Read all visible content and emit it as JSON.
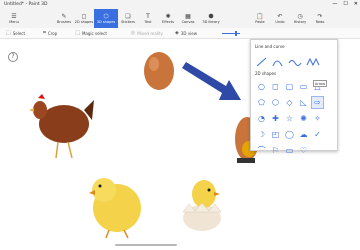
{
  "window": {
    "title": "Untitled* - Paint 3D"
  },
  "ribbon": [
    {
      "label": "Menu",
      "icon": "menu-icon"
    },
    {
      "label": "Brushes",
      "icon": "brush-icon"
    },
    {
      "label": "2D shapes",
      "icon": "shapes2d-icon"
    },
    {
      "label": "3D shapes",
      "icon": "shapes3d-icon"
    },
    {
      "label": "Stickers",
      "icon": "sticker-icon"
    },
    {
      "label": "Text",
      "icon": "text-icon"
    },
    {
      "label": "Effects",
      "icon": "effects-icon"
    },
    {
      "label": "Canvas",
      "icon": "canvas-icon"
    },
    {
      "label": "3D library",
      "icon": "library-icon"
    },
    {
      "label": "Paste",
      "icon": "paste-icon"
    },
    {
      "label": "Undo",
      "icon": "undo-icon"
    },
    {
      "label": "History",
      "icon": "history-icon"
    },
    {
      "label": "Redo",
      "icon": "redo-icon"
    }
  ],
  "toolbar": {
    "select": "Select",
    "crop": "Crop",
    "magic_select": "Magic select",
    "mixed_reality": "Mixed reality",
    "view_3d": "3D view"
  },
  "help": "?",
  "panel": {
    "line_curve_title": "Line and curve",
    "shapes_title": "2D shapes",
    "tooltip": "Arrow"
  },
  "colors": {
    "accent": "#3a6fe0",
    "arrow": "#2f4aa6"
  }
}
